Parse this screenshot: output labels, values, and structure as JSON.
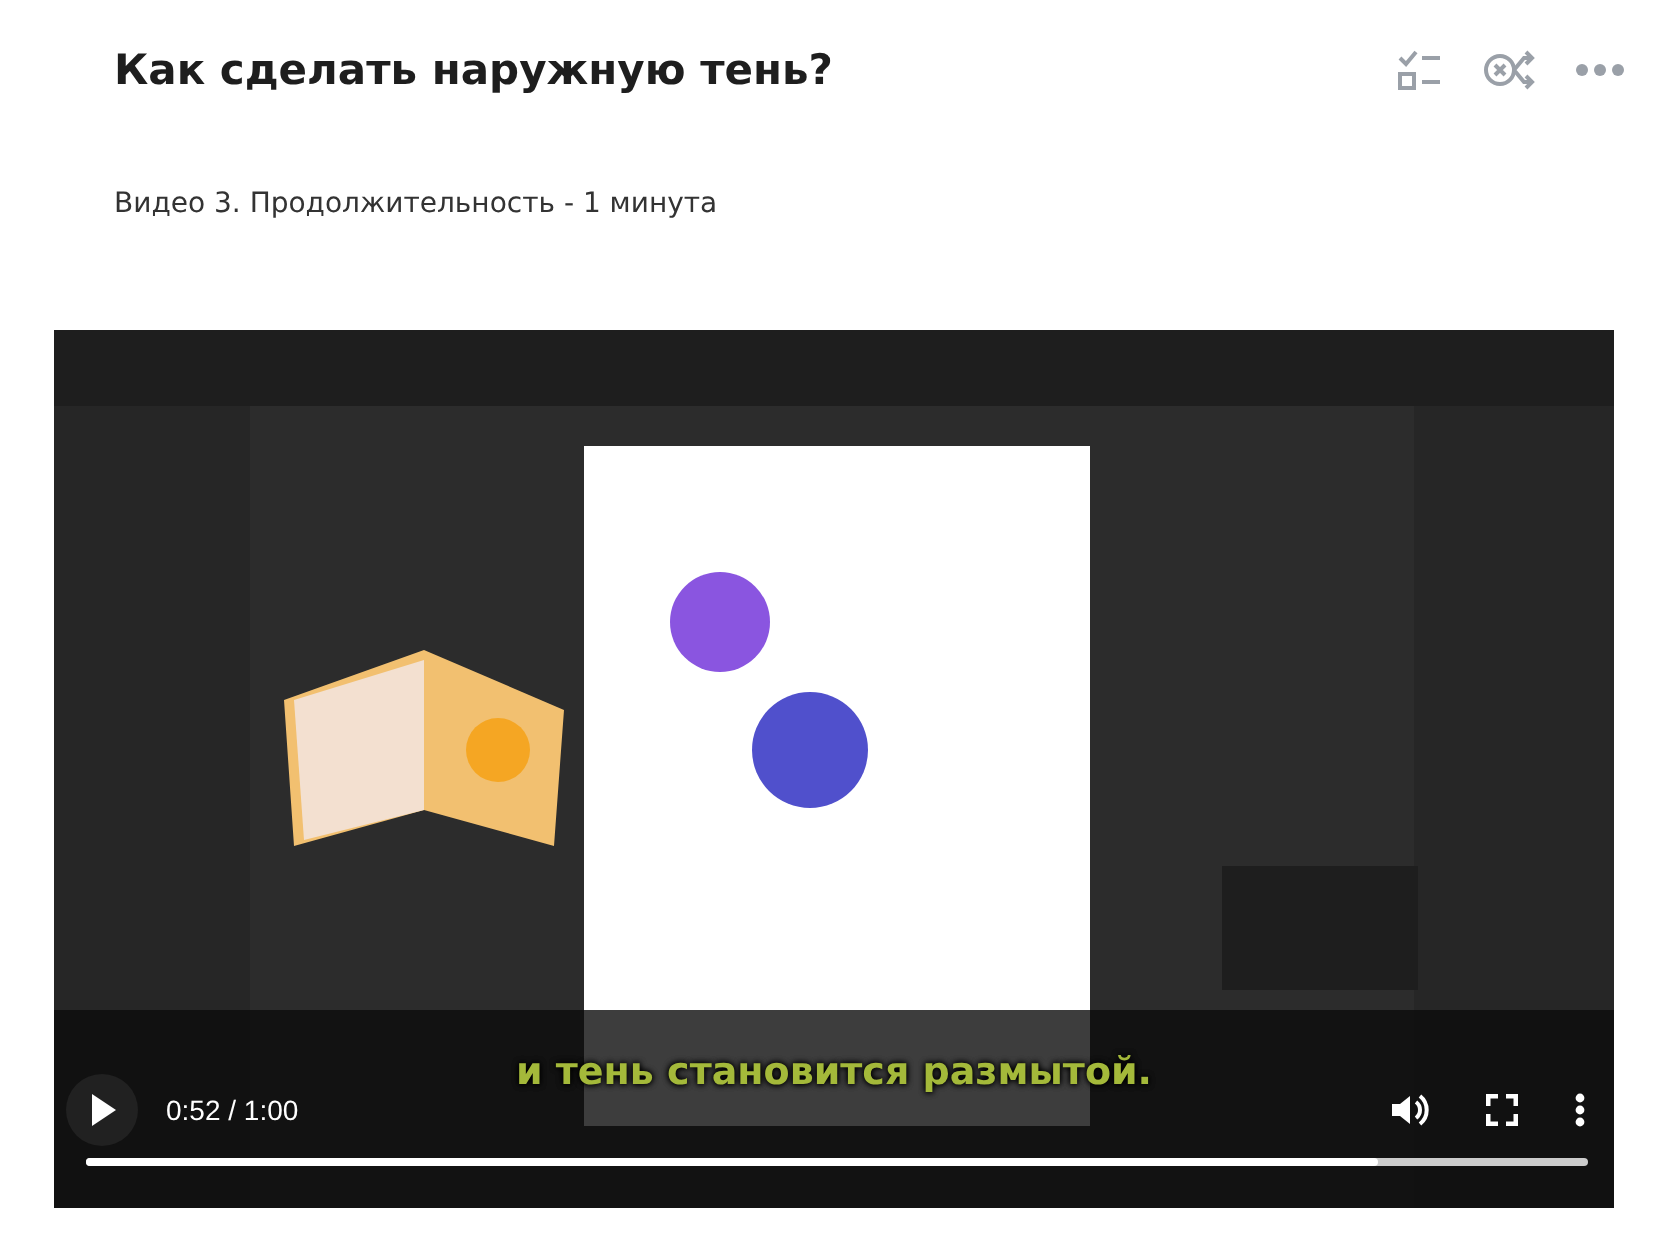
{
  "title": "Как сделать наружную тень?",
  "subtitle": "Видео 3. Продолжительность - 1 минута",
  "video": {
    "kind": "picture",
    "caption": "и тень становится размытой.",
    "time": "0:52 / 1:00",
    "playing": false,
    "progress": {
      "level": 0.86
    }
  }
}
